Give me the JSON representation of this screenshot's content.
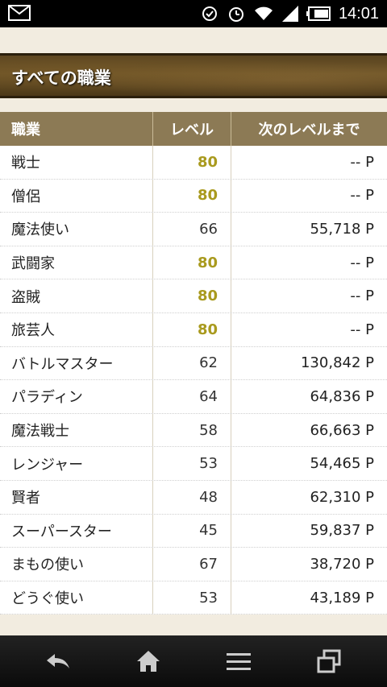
{
  "status_bar": {
    "time": "14:01",
    "icons": [
      "mail-icon",
      "sync-icon",
      "alarm-icon",
      "wifi-icon",
      "signal-icon",
      "battery-icon"
    ]
  },
  "banner": {
    "title": "すべての職業"
  },
  "table": {
    "headers": [
      "職業",
      "レベル",
      "次のレベルまで"
    ],
    "rows": [
      {
        "job": "戦士",
        "level": "80",
        "next": "-- P",
        "max": true
      },
      {
        "job": "僧侶",
        "level": "80",
        "next": "-- P",
        "max": true
      },
      {
        "job": "魔法使い",
        "level": "66",
        "next": "55,718 P",
        "max": false
      },
      {
        "job": "武闘家",
        "level": "80",
        "next": "-- P",
        "max": true
      },
      {
        "job": "盗賊",
        "level": "80",
        "next": "-- P",
        "max": true
      },
      {
        "job": "旅芸人",
        "level": "80",
        "next": "-- P",
        "max": true
      },
      {
        "job": "バトルマスター",
        "level": "62",
        "next": "130,842 P",
        "max": false
      },
      {
        "job": "パラディン",
        "level": "64",
        "next": "64,836 P",
        "max": false
      },
      {
        "job": "魔法戦士",
        "level": "58",
        "next": "66,663 P",
        "max": false
      },
      {
        "job": "レンジャー",
        "level": "53",
        "next": "54,465 P",
        "max": false
      },
      {
        "job": "賢者",
        "level": "48",
        "next": "62,310 P",
        "max": false
      },
      {
        "job": "スーパースター",
        "level": "45",
        "next": "59,837 P",
        "max": false
      },
      {
        "job": "まもの使い",
        "level": "67",
        "next": "38,720 P",
        "max": false
      },
      {
        "job": "どうぐ使い",
        "level": "53",
        "next": "43,189 P",
        "max": false
      }
    ]
  },
  "colors": {
    "max_level": "#a99a1e",
    "header_bg": "#8c7a55",
    "banner_bg": "#5a4420"
  },
  "nav": [
    "back-icon",
    "home-icon",
    "menu-icon",
    "recent-apps-icon"
  ]
}
